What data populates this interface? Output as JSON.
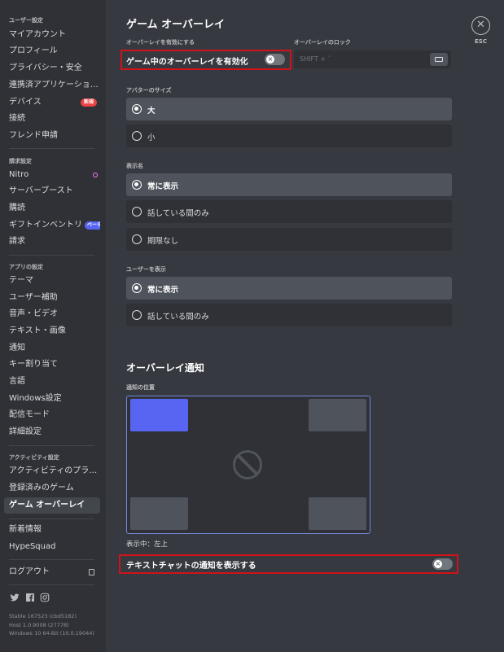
{
  "sidebar": {
    "user_settings_header": "ユーザー設定",
    "user_items": [
      "マイアカウント",
      "プロフィール",
      "プライバシー・安全",
      "連携済アプリケーショ…",
      "デバイス",
      "接続",
      "フレンド申請"
    ],
    "devices_badge": "新規",
    "billing_header": "請求設定",
    "billing_items": [
      "Nitro",
      "サーバーブースト",
      "購読",
      "ギフトインベントリ",
      "請求"
    ],
    "gift_badge": "ベータ",
    "app_header": "アプリの設定",
    "app_items": [
      "テーマ",
      "ユーザー補助",
      "音声・ビデオ",
      "テキスト・画像",
      "通知",
      "キー割り当て",
      "言語",
      "Windows設定",
      "配信モード",
      "詳細設定"
    ],
    "activity_header": "アクティビティ設定",
    "activity_items": [
      "アクティビティのプラ…",
      "登録済みのゲーム",
      "ゲーム オーバーレイ"
    ],
    "misc_items": [
      "新着情報",
      "HypeSquad"
    ],
    "logout": "ログアウト",
    "version_lines": [
      "Stable 167523 (cbd5182)",
      "Host 1.0.9008 (27778)",
      "Windows 10 64-Bit (10.0.19044)"
    ]
  },
  "main": {
    "title": "ゲーム オーバーレイ",
    "enable_overlay_label": "オーバーレイを有効にする",
    "enable_overlay_toggle_text": "ゲーム中のオーバーレイを有効化",
    "enable_overlay_state": "off",
    "lock_label": "オーバーレイのロック",
    "lock_keybind": "SHIFT + `",
    "avatar_size_label": "アバターのサイズ",
    "avatar_size_options": [
      "大",
      "小"
    ],
    "avatar_size_selected": "大",
    "display_name_label": "表示名",
    "display_name_options": [
      "常に表示",
      "話している間のみ",
      "期限なし"
    ],
    "display_name_selected": "常に表示",
    "show_users_label": "ユーザーを表示",
    "show_users_options": [
      "常に表示",
      "話している間のみ"
    ],
    "show_users_selected": "常に表示",
    "notif_title": "オーバーレイ通知",
    "notif_position_label": "通知の位置",
    "notif_position_status": "表示中：左上",
    "text_chat_toggle_text": "テキストチャットの通知を表示する",
    "text_chat_state": "off",
    "close_glyph": "✕",
    "esc_label": "ESC"
  },
  "colors": {
    "accent": "#5865f2",
    "highlight": "#d0121b",
    "new_badge": "#ed4245"
  }
}
